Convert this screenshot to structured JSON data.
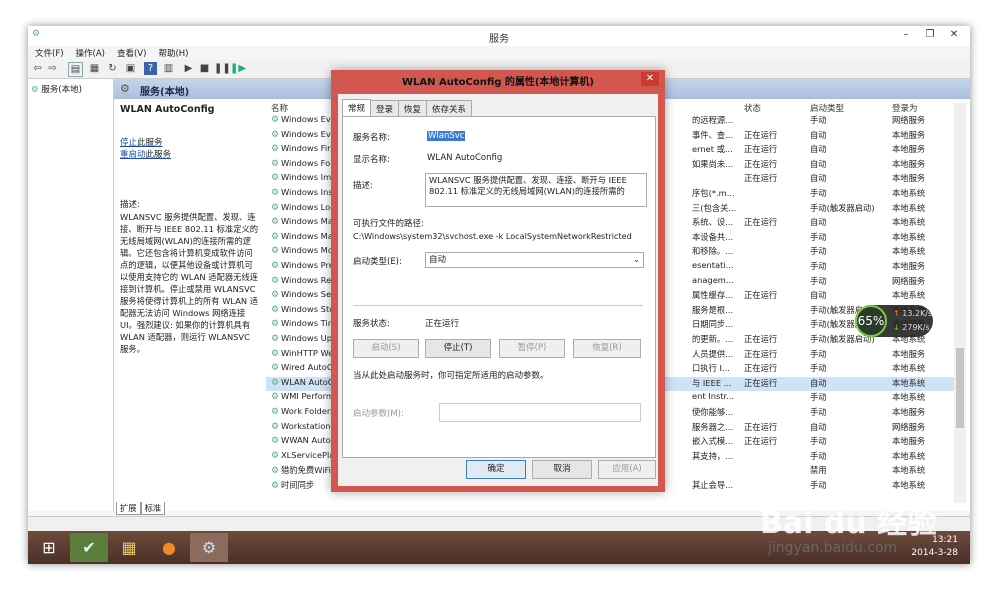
{
  "window": {
    "title": "服务",
    "controls": {
      "min": "–",
      "restore": "❐",
      "close": "✕"
    }
  },
  "menu": [
    "文件(F)",
    "操作(A)",
    "查看(V)",
    "帮助(H)"
  ],
  "tree": {
    "root": "服务(本地)"
  },
  "pane": {
    "header": "服务(本地)"
  },
  "description_panel": {
    "title": "WLAN AutoConfig",
    "stop_link": "停止",
    "stop_rest": "此服务",
    "restart_link": "重启动",
    "restart_rest": "此服务",
    "desc_label": "描述:",
    "desc_text": "WLANSVC 服务提供配置、发现、连接、断开与 IEEE 802.11 标准定义的无线局域网(WLAN)的连接所需的逻辑。它还包含将计算机变成软件访问点的逻辑，以便其他设备或计算机可以使用支持它的 WLAN 适配器无线连接到计算机。停止或禁用 WLANSVC 服务将使得计算机上的所有 WLAN 适配器无法访问 Windows 网络连接 UI。强烈建议: 如果你的计算机具有 WLAN 适配器，则运行 WLANSVC 服务。"
  },
  "columns": {
    "name": "名称",
    "status": "状态",
    "startup": "启动类型",
    "logon": "登录为"
  },
  "rows": [
    {
      "name": "Windows Eve",
      "desc": "的远程源...",
      "status": "",
      "startup": "手动",
      "logon": "网络服务"
    },
    {
      "name": "Windows Eve",
      "desc": "事件、查...",
      "status": "正在运行",
      "startup": "自动",
      "logon": "本地服务"
    },
    {
      "name": "Windows Fire",
      "desc": "ernet 或...",
      "status": "正在运行",
      "startup": "自动",
      "logon": "本地服务"
    },
    {
      "name": "Windows For",
      "desc": "如果尚未...",
      "status": "正在运行",
      "startup": "自动",
      "logon": "本地服务"
    },
    {
      "name": "Windows Ima",
      "desc": "",
      "status": "正在运行",
      "startup": "自动",
      "logon": "本地服务"
    },
    {
      "name": "Windows Inst",
      "desc": "序包(*.m...",
      "status": "",
      "startup": "手动",
      "logon": "本地系统"
    },
    {
      "name": "Windows Loc",
      "desc": "三(包含关...",
      "status": "",
      "startup": "手动(触发器启动)",
      "logon": "本地系统"
    },
    {
      "name": "Windows Ma",
      "desc": "系统、设...",
      "status": "正在运行",
      "startup": "自动",
      "logon": "本地系统"
    },
    {
      "name": "Windows Ma",
      "desc": "本设备共...",
      "status": "",
      "startup": "手动",
      "logon": "本地系统"
    },
    {
      "name": "Windows Mo",
      "desc": "和移除。...",
      "status": "",
      "startup": "手动",
      "logon": "本地系统"
    },
    {
      "name": "Windows Pre",
      "desc": "esentati...",
      "status": "",
      "startup": "手动",
      "logon": "本地服务"
    },
    {
      "name": "Windows Ren",
      "desc": "anagem...",
      "status": "",
      "startup": "手动",
      "logon": "网络服务"
    },
    {
      "name": "Windows Sea",
      "desc": "属性缓存...",
      "status": "正在运行",
      "startup": "自动",
      "logon": "本地系统"
    },
    {
      "name": "Windows Sto",
      "desc": "服务是根...",
      "status": "",
      "startup": "手动(触发器启动)",
      "logon": "本地系统"
    },
    {
      "name": "Windows Tim",
      "desc": "日期同步...",
      "status": "",
      "startup": "手动(触发器启动)",
      "logon": "本地服务"
    },
    {
      "name": "Windows Upc",
      "desc": "的更新。...",
      "status": "正在运行",
      "startup": "手动(触发器启动)",
      "logon": "本地系统"
    },
    {
      "name": "WinHTTP We",
      "desc": "人员提供...",
      "status": "正在运行",
      "startup": "手动",
      "logon": "本地服务"
    },
    {
      "name": "Wired AutoC",
      "desc": "口执行 I...",
      "status": "正在运行",
      "startup": "手动",
      "logon": "本地系统"
    },
    {
      "name": "WLAN AutoC",
      "desc": "与 IEEE ...",
      "status": "正在运行",
      "startup": "自动",
      "logon": "本地系统"
    },
    {
      "name": "WMI Perform",
      "desc": "ent Instr...",
      "status": "",
      "startup": "手动",
      "logon": "本地系统"
    },
    {
      "name": "Work Folders",
      "desc": "使你能够...",
      "status": "",
      "startup": "手动",
      "logon": "本地服务"
    },
    {
      "name": "Workstation",
      "desc": "服务器之...",
      "status": "正在运行",
      "startup": "自动",
      "logon": "网络服务"
    },
    {
      "name": "WWAN Auto",
      "desc": "嵌入式模...",
      "status": "正在运行",
      "startup": "手动",
      "logon": "本地服务"
    },
    {
      "name": "XLServicePlat",
      "desc": "其支持，...",
      "status": "",
      "startup": "手动",
      "logon": "本地系统"
    },
    {
      "name": "猎豹免费WiFi",
      "desc": "",
      "status": "",
      "startup": "禁用",
      "logon": "本地系统"
    },
    {
      "name": "时间同步",
      "desc": "其止会导...",
      "status": "",
      "startup": "手动",
      "logon": "本地系统"
    }
  ],
  "bottom_tabs": [
    "扩展",
    "标准"
  ],
  "dialog": {
    "title": "WLAN AutoConfig 的属性(本地计算机)",
    "close": "✕",
    "tabs": [
      "常规",
      "登录",
      "恢复",
      "依存关系"
    ],
    "service_name_label": "服务名称:",
    "service_name": "WlanSvc",
    "display_name_label": "显示名称:",
    "display_name": "WLAN AutoConfig",
    "desc_label": "描述:",
    "desc": "WLANSVC 服务提供配置、发现、连接、断开与 IEEE 802.11 标准定义的无线局域网(WLAN)的连接所需的",
    "path_label": "可执行文件的路径:",
    "path": "C:\\Windows\\system32\\svchost.exe -k LocalSystemNetworkRestricted",
    "startup_label": "启动类型(E):",
    "startup_value": "自动",
    "status_label": "服务状态:",
    "status_value": "正在运行",
    "buttons": {
      "start": "启动(S)",
      "stop": "停止(T)",
      "pause": "暂停(P)",
      "resume": "恢复(R)"
    },
    "hint": "当从此处启动服务时，你可指定所适用的启动参数。",
    "param_label": "启动参数(M):",
    "ok": "确定",
    "cancel": "取消",
    "apply": "应用(A)"
  },
  "net_widget": {
    "percent": "65%",
    "up": "13.2K/s",
    "down": "279K/s"
  },
  "clock": {
    "time": "13:21",
    "date": "2014-3-28"
  },
  "watermark": {
    "brand": "Bai du 经验",
    "url": "jingyan.baidu.com"
  }
}
